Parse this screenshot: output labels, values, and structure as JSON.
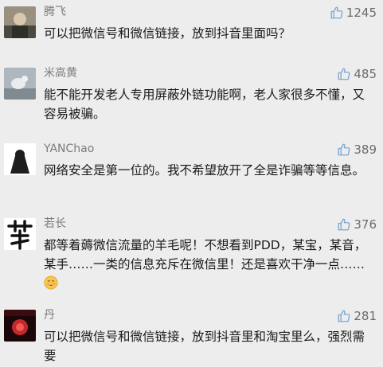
{
  "colors": {
    "background": "#ededed",
    "name": "#7b7b7b",
    "text": "#1a1a1a",
    "like": "#6c6c6c"
  },
  "comments": [
    {
      "name": "腾飞",
      "likes": "1245",
      "text": "可以把微信号和微信链接，放到抖音里面吗？"
    },
    {
      "name": "米高黄",
      "likes": "485",
      "text": "能不能开发老人专用屏蔽外链功能啊，老人家很多不懂，又容易被骗。"
    },
    {
      "name": "YANChao",
      "likes": "389",
      "text": "网络安全是第一位的。我不希望放开了全是诈骗等等信息。"
    },
    {
      "name": "若长",
      "likes": "376",
      "text": "都等着薅微信流量的羊毛呢！不想看到PDD，某宝，某音，某手……一类的信息充斥在微信里！还是喜欢干净一点……",
      "avatar_text": "若长"
    },
    {
      "name": "丹",
      "likes": "281",
      "text": "可以把微信号和微信链接，放到抖音里和淘宝里么，强烈需要"
    }
  ]
}
